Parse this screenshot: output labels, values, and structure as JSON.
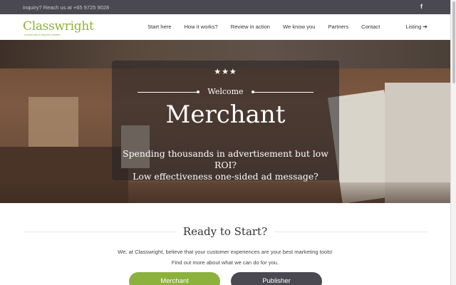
{
  "topbar": {
    "inquiry": "Inquiry? Reach us at +65 9725 9028",
    "facebook_icon": "f"
  },
  "logo": {
    "name": "Classwright",
    "tagline": "a social way to discover creators"
  },
  "menu": [
    {
      "label": "Start here"
    },
    {
      "label": "How it works?"
    },
    {
      "label": "Review in action"
    },
    {
      "label": "We know you"
    },
    {
      "label": "Partners"
    },
    {
      "label": "Contact"
    },
    {
      "label": "Listing",
      "arrow": "➔"
    }
  ],
  "hero": {
    "stars": "★★★",
    "welcome": "Welcome",
    "title": "Merchant",
    "subtitle_line1": "Spending thousands in advertisement but low ROI?",
    "subtitle_line2": "Low effectiveness one-sided ad message?"
  },
  "ready": {
    "title": "Ready to Start?",
    "line1": "We, at Classwright, believe that your customer experiences are your best marketing tools!",
    "line2": "Find out more about what we can do for you.",
    "merchant_button": "Merchant",
    "publisher_button": "Publisher"
  },
  "colors": {
    "brand_green": "#8cb13c",
    "dark": "#4a4850"
  }
}
